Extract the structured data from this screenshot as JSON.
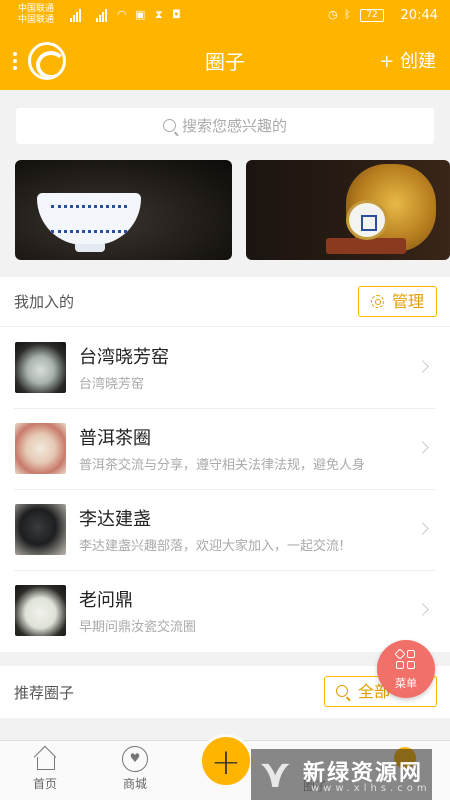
{
  "status_bar": {
    "carrier_1": "中国联通",
    "carrier_2": "中国联通",
    "network_1": "4G",
    "network_2": "3G",
    "battery": "72",
    "time": "20:44"
  },
  "header": {
    "title": "圈子",
    "create_label": "+ 创建"
  },
  "search": {
    "placeholder": "搜索您感兴趣的"
  },
  "joined_section": {
    "title": "我加入的",
    "manage_label": "管理"
  },
  "circles": [
    {
      "name": "台湾晓芳窑",
      "desc": "台湾晓芳窑"
    },
    {
      "name": "普洱茶圈",
      "desc": "普洱茶交流与分享，遵守相关法律法规，避免人身"
    },
    {
      "name": "李达建盏",
      "desc": "李达建盏兴趣部落，欢迎大家加入，一起交流!"
    },
    {
      "name": "老问鼎",
      "desc": "早期问鼎汝瓷交流圈"
    }
  ],
  "recommend_section": {
    "title": "推荐圈子",
    "all_label": "全部"
  },
  "floating_menu": {
    "label": "菜单"
  },
  "tab_bar": {
    "home": "首页",
    "shop": "商城",
    "plus": "+",
    "partial_label": "圈子"
  },
  "watermark": {
    "text": "新绿资源网",
    "url": "www.xlhs.com"
  },
  "colors": {
    "brand": "#ffb400",
    "menu_fab": "#f2706a"
  }
}
